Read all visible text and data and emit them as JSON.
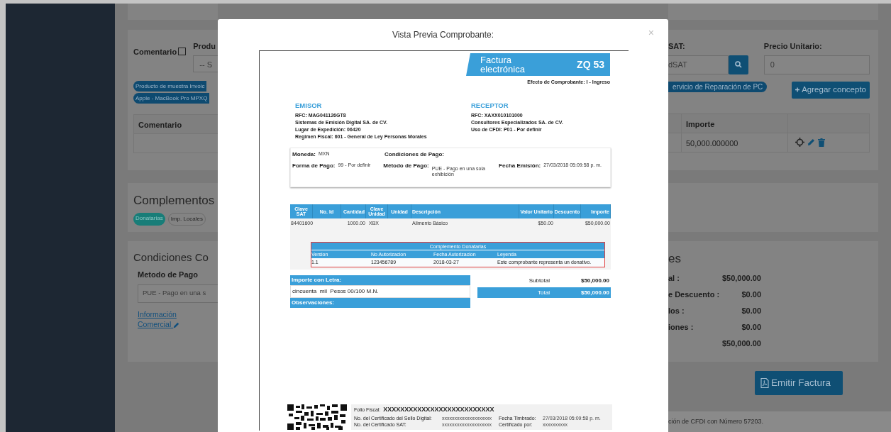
{
  "concepts": {
    "comment_label": "Comentario",
    "comment_checked": false,
    "product_label": "Produ",
    "product_value": "-- S",
    "sat_label": "SAT:",
    "sat_value": "dSAT",
    "price_label": "Precio Unitario:",
    "price_value": "0",
    "tags": [
      {
        "text": "Producto de muestra Invoic"
      },
      {
        "text": "Apple - MacBook Pro MPXQ"
      },
      {
        "text": "ervicio de Reparación de PC"
      }
    ],
    "add_button": "Agregar concepto",
    "table": {
      "columns": [
        "Comentario",
        "Importe"
      ],
      "rows": [
        {
          "importe": "50,000.000000"
        }
      ]
    }
  },
  "complements": {
    "title": "Complementos",
    "tags": [
      {
        "text": "Donatarias",
        "selected": true
      },
      {
        "text": "Imp. Locales",
        "selected": false
      }
    ]
  },
  "conditions": {
    "title": "Condiciones Co",
    "payment_label": "Metodo de Pago",
    "payment_value": "PUE - Pago en una s",
    "link": "Información Comercial"
  },
  "totals": {
    "title": "es",
    "rows": [
      {
        "label": "al :",
        "value": "$50,000.00"
      },
      {
        "label": "e Descuento :",
        "value": "$0.00"
      },
      {
        "label": "los :",
        "value": "$0.00"
      },
      {
        "label": "iones :",
        "value": "$0.00"
      },
      {
        "value": "$50,000.00"
      }
    ]
  },
  "emit_button": "Emitir Factura",
  "footer": "ción de CFDI con Número 57203.",
  "modal": {
    "title": "Vista Previa Comprobante:",
    "close": "×",
    "document": {
      "title": "Factura electrónica",
      "folio": "ZQ 53",
      "effect": "Efecto de Comprobante: I - Ingreso",
      "emisor": {
        "heading": "EMISOR",
        "lines": [
          "RFC: MAG041126GT8",
          "Sistemas de Emisión Digital SA. de CV.",
          "Lugar de Expedición: 06420",
          "Regimen Fiscal: 601 - General de Ley Personas Morales"
        ]
      },
      "receptor": {
        "heading": "RECEPTOR",
        "lines": [
          "RFC: XAXX010101000",
          "Consultores Especializados SA. de CV.",
          "Uso de CFDI: P01 - Por definir"
        ]
      },
      "info_rows": [
        [
          {
            "label": "Moneda:",
            "value": "MXN"
          },
          {
            "label": "Condiciones de Pago:"
          }
        ],
        [
          {
            "label": "Forma de Pago:",
            "value": "99 - Por definir"
          },
          {
            "label": "Método de Pago:",
            "value": "PUE - Pago en una sola exhibición"
          },
          {
            "label": "Fecha Emisión:",
            "value": "27/03/2018 05:09:58 p. m."
          }
        ]
      ],
      "items": {
        "columns": [
          "Clave SAT",
          "No. Id",
          "Cantidad",
          "Clave Unidad",
          "Unidad",
          "Descripción",
          "Valor Unitario",
          "Descuento",
          "Importe"
        ],
        "rows": [
          [
            "84401600",
            null,
            "1000.00",
            "XBX",
            null,
            "Alimento Básico",
            "$50.00",
            null,
            "$50,000.00"
          ]
        ]
      },
      "complement": {
        "title": "Complemento Donatarias",
        "columns": [
          "Version",
          "No Autorizacion",
          "Fecha Autorizacion",
          "Leyenda"
        ],
        "rows": [
          [
            "1.1",
            "123456789",
            "2018-03-27",
            "Este comprobante representa un donativo."
          ]
        ]
      },
      "amount_words": {
        "label": "Importe con Letra:",
        "value": "cincuenta  mil  Pesos 00/100 M.N.",
        "observations": "Observaciones:"
      },
      "totals": [
        {
          "label": "Subtotal",
          "value": "$50,000.00",
          "highlight": false
        },
        {
          "label": "Total",
          "value": "$50,000.00",
          "highlight": true
        }
      ],
      "stamp": {
        "folio_label": "Folio Fiscal:",
        "folio": "XXXXXXXXXXXXXXXXXXXXXXXXXX",
        "fields": [
          {
            "label": "No. del Certificado del Sello Digital:",
            "value": "xxxxxxxxxxxxxxxxxxxx"
          },
          {
            "label": "Fecha Timbrado:",
            "value": "27/03/2018 05:09:58 p. m."
          },
          {
            "label": "No. del Certificado SAT:",
            "value": "xxxxxxxxxxxxxxxxxxxx"
          },
          {
            "label": "Certificado por:",
            "value": "xxxxxxxxxx"
          }
        ]
      }
    }
  }
}
